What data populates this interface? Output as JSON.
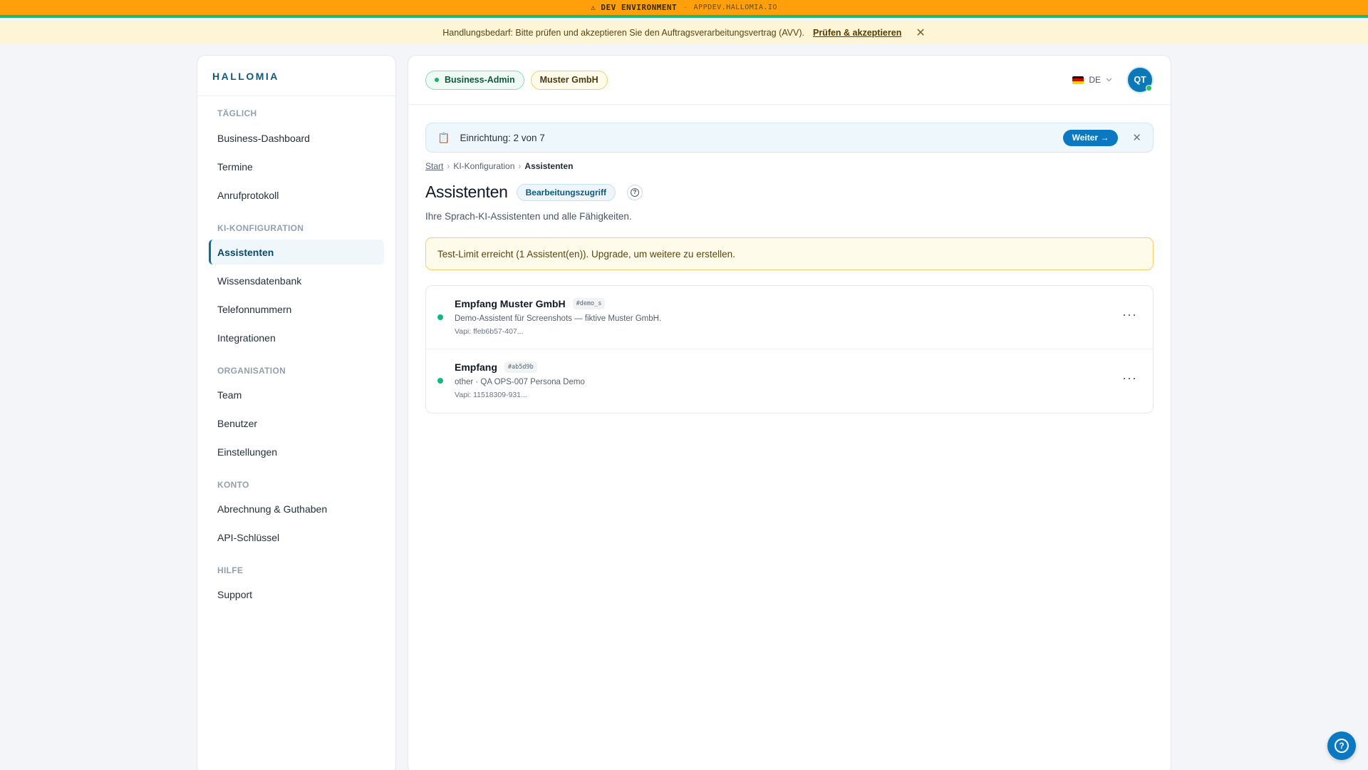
{
  "dev_banner": {
    "warning_icon": "warning-icon",
    "label": "⚠ DEV ENVIRONMENT",
    "separator": "·",
    "host": "APPDEV.HALLOMIA.IO"
  },
  "notice": {
    "text": "Handlungsbedarf: Bitte prüfen und akzeptieren Sie den Auftragsverarbeitungsvertrag (AVV).",
    "link": "Prüfen & akzeptieren",
    "close_icon": "close-icon"
  },
  "sidebar": {
    "brand": "HALLOMIA",
    "sections": [
      {
        "title": "TÄGLICH",
        "items": [
          "Business-Dashboard",
          "Termine",
          "Anrufprotokoll"
        ]
      },
      {
        "title": "KI-KONFIGURATION",
        "items": [
          "Assistenten",
          "Wissensdatenbank",
          "Telefonnummern",
          "Integrationen"
        ]
      },
      {
        "title": "ORGANISATION",
        "items": [
          "Team",
          "Benutzer",
          "Einstellungen"
        ]
      },
      {
        "title": "KONTO",
        "items": [
          "Abrechnung & Guthaben",
          "API-Schlüssel"
        ]
      },
      {
        "title": "HILFE",
        "items": [
          "Support"
        ]
      }
    ],
    "active_item": "Assistenten"
  },
  "header": {
    "role_badge": "Business-Admin",
    "org_badge": "Muster GmbH",
    "language": "DE",
    "flag_icon": "german-flag-icon",
    "avatar_initials": "QT",
    "colors": {
      "accent": "#0b78c2",
      "success": "#16b26a",
      "warning_border": "#f3cf66"
    }
  },
  "setup_banner": {
    "icon": "clipboard-icon",
    "text": "Einrichtung: 2 von 7",
    "button": "Weiter →"
  },
  "breadcrumb": {
    "items": [
      "Start",
      "KI-Konfiguration",
      "Assistenten"
    ],
    "separator": "›"
  },
  "page": {
    "title": "Assistenten",
    "access_badge": "Bearbeitungszugriff",
    "subtitle": "Ihre Sprach-KI-Assistenten und alle Fähigkeiten.",
    "alert": "Test-Limit erreicht (1 Assistent(en)). Upgrade, um weitere zu erstellen."
  },
  "assistants": [
    {
      "name": "Empfang Muster GmbH",
      "tag": "#demo_s",
      "description": "Demo-Assistent für Screenshots — fiktive Muster GmbH.",
      "vapi": "Vapi: ffeb6b57-407...",
      "menu": "···"
    },
    {
      "name": "Empfang",
      "tag": "#ab5d9b",
      "description": "other · QA OPS-007 Persona Demo",
      "vapi": "Vapi: 11518309-931...",
      "menu": "···"
    }
  ]
}
